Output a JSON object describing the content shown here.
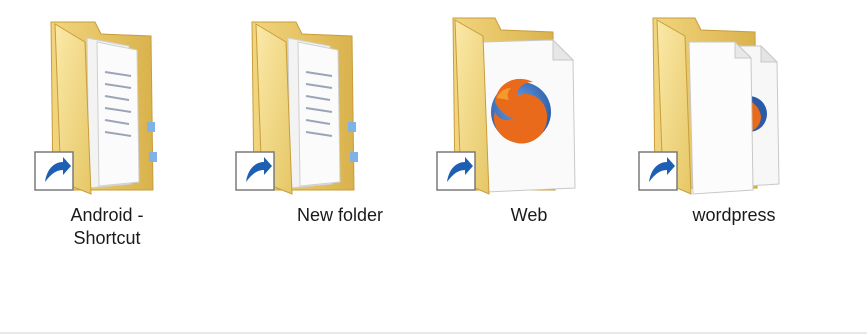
{
  "window": {
    "view": "Large icons"
  },
  "items": [
    {
      "label": "Android -\nShortcut",
      "icon": "folder-documents-shortcut-icon",
      "overlay": "shortcut-arrow-icon"
    },
    {
      "label": "New folder",
      "icon": "folder-documents-shortcut-icon",
      "overlay": "shortcut-arrow-icon"
    },
    {
      "label": "Web",
      "icon": "folder-firefox-shortcut-icon",
      "overlay": "shortcut-arrow-icon"
    },
    {
      "label": "wordpress",
      "icon": "folder-pages-shortcut-icon",
      "overlay": "shortcut-arrow-icon"
    }
  ],
  "colors": {
    "folder_back": "#e8c96a",
    "folder_front": "#f6e19a",
    "paper": "#fafafa",
    "shortcut_blue": "#1e5fb3",
    "firefox_orange": "#e86a1a",
    "firefox_blue": "#2a5aa8"
  }
}
